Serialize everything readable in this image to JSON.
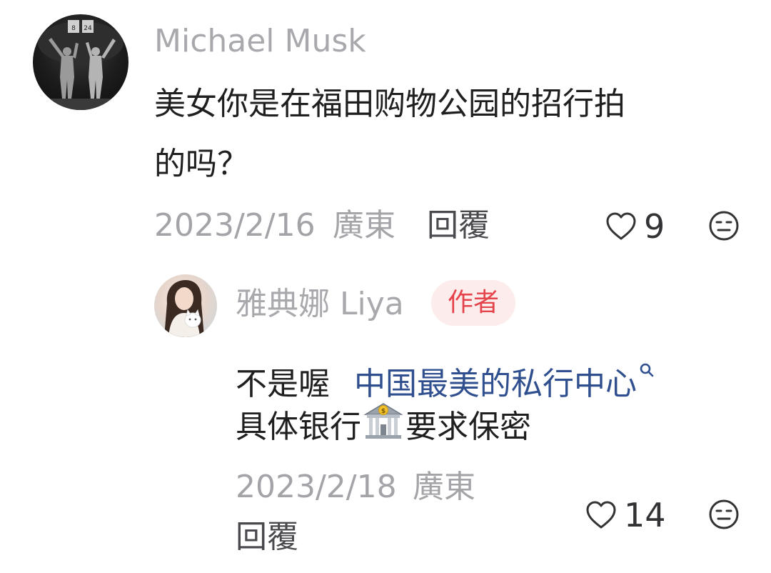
{
  "comment": {
    "username": "Michael Musk",
    "text_line1": "美女你是在福田购物公园的招行拍",
    "text_line2": "的吗？",
    "date": "2023/2/16",
    "location": "廣東",
    "reply_label": "回覆",
    "likes": "9",
    "avatar_icon": "basketball-players-avatar",
    "avatar_jerseys": [
      "8",
      "24"
    ]
  },
  "reply": {
    "username": "雅典娜 Liya",
    "author_badge": "作者",
    "text_prefix": "不是喔",
    "link_text": "中国最美的私行中心",
    "text_line2_before": "具体银行",
    "text_line2_after": "要求保密",
    "date": "2023/2/18",
    "location": "廣東",
    "reply_label": "回覆",
    "likes": "14",
    "avatar_icon": "woman-with-cat-avatar"
  },
  "icons": {
    "like": "heart-outline-icon",
    "dislike": "neutral-face-icon",
    "search": "search-icon",
    "bank": "bank-emoji-icon"
  },
  "colors": {
    "username": "#a9a9ad",
    "text": "#1f1f1f",
    "meta": "#a4a4a8",
    "link": "#2f4f8f",
    "badge_bg": "#fdecec",
    "badge_text": "#e5434b"
  }
}
